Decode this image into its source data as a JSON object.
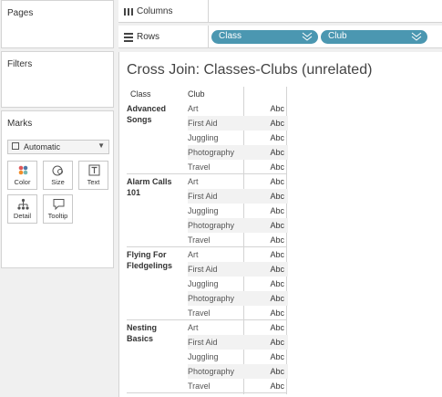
{
  "sidebar": {
    "pages_label": "Pages",
    "filters_label": "Filters",
    "marks_label": "Marks",
    "marks_type": "Automatic",
    "mark_buttons": [
      {
        "label": "Color",
        "icon": "color-icon"
      },
      {
        "label": "Size",
        "icon": "size-icon"
      },
      {
        "label": "Text",
        "icon": "text-icon"
      },
      {
        "label": "Detail",
        "icon": "detail-icon"
      },
      {
        "label": "Tooltip",
        "icon": "tooltip-icon"
      }
    ]
  },
  "shelves": {
    "columns_label": "Columns",
    "rows_label": "Rows",
    "rows_pills": [
      "Class",
      "Club"
    ]
  },
  "colors": {
    "pill": "#4b97b1",
    "stripe": "#f2f2f2"
  },
  "view": {
    "title": "Cross Join: Classes-Clubs (unrelated)",
    "headers": [
      "Class",
      "Club"
    ],
    "cell_value": "Abc",
    "classes": [
      {
        "name": "Advanced Songs",
        "clubs": [
          "Art",
          "First Aid",
          "Juggling",
          "Photography",
          "Travel"
        ]
      },
      {
        "name": "Alarm Calls 101",
        "clubs": [
          "Art",
          "First Aid",
          "Juggling",
          "Photography",
          "Travel"
        ]
      },
      {
        "name": "Flying For Fledgelings",
        "clubs": [
          "Art",
          "First Aid",
          "Juggling",
          "Photography",
          "Travel"
        ]
      },
      {
        "name": "Nesting Basics",
        "clubs": [
          "Art",
          "First Aid",
          "Juggling",
          "Photography",
          "Travel"
        ]
      }
    ]
  }
}
